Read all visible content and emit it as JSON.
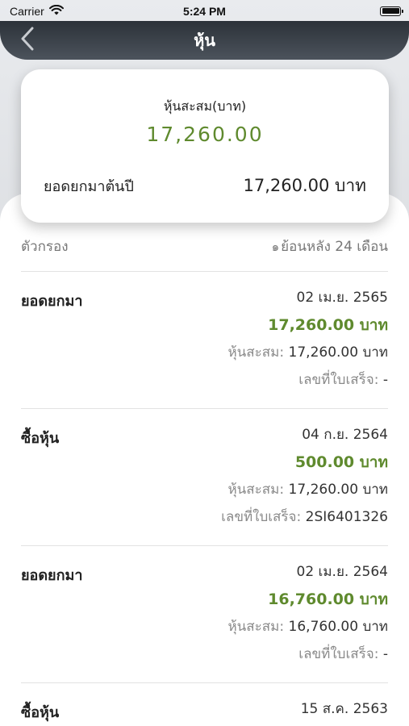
{
  "status_bar": {
    "carrier": "Carrier",
    "time": "5:24 PM"
  },
  "nav": {
    "title": "หุ้น",
    "back_icon": "chevron-left-icon"
  },
  "summary": {
    "label": "หุ้นสะสม(บาท)",
    "amount": "17,260.00",
    "brought_forward_label": "ยอดยกมาต้นปี",
    "brought_forward_value": "17,260.00 บาท"
  },
  "filter": {
    "label": "ตัวกรอง",
    "period_icon": "clock-icon",
    "period_glyph": "๑",
    "period_text": "ย้อนหลัง 24 เดือน"
  },
  "transactions": [
    {
      "type": "ยอดยกมา",
      "date": "02 เม.ย. 2565",
      "amount": "17,260.00 บาท",
      "cumulative_label": "หุ้นสะสม:",
      "cumulative_value": "17,260.00 บาท",
      "receipt_label": "เลขที่ใบเสร็จ:",
      "receipt_value": "-"
    },
    {
      "type": "ซื้อหุ้น",
      "date": "04 ก.ย. 2564",
      "amount": "500.00 บาท",
      "cumulative_label": "หุ้นสะสม:",
      "cumulative_value": "17,260.00 บาท",
      "receipt_label": "เลขที่ใบเสร็จ:",
      "receipt_value": "2SI6401326"
    },
    {
      "type": "ยอดยกมา",
      "date": "02 เม.ย. 2564",
      "amount": "16,760.00 บาท",
      "cumulative_label": "หุ้นสะสม:",
      "cumulative_value": "16,760.00 บาท",
      "receipt_label": "เลขที่ใบเสร็จ:",
      "receipt_value": "-"
    },
    {
      "type": "ซื้อหุ้น",
      "date": "15 ส.ค. 2563"
    }
  ],
  "colors": {
    "accent_green": "#5f8a2e",
    "nav_dark": "#2c3239"
  }
}
